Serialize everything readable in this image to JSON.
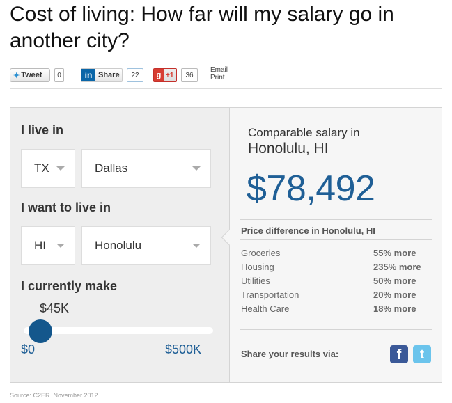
{
  "title": "Cost of living: How far will my salary go in another city?",
  "share": {
    "tweet_label": "Tweet",
    "tweet_count": "0",
    "linkedin_label": "Share",
    "linkedin_count": "22",
    "gplus_label": "+1",
    "gplus_count": "36",
    "email_label": "Email",
    "print_label": "Print"
  },
  "form": {
    "live_in_heading": "I live in",
    "current_state": "TX",
    "current_city": "Dallas",
    "want_heading": "I want to live in",
    "target_state": "HI",
    "target_city": "Honolulu",
    "make_heading": "I currently make",
    "salary_value": "$45K",
    "salary_fraction": 0.09,
    "slider_min": "$0",
    "slider_max": "$500K"
  },
  "results": {
    "comparable_line1": "Comparable salary in",
    "comparable_city": "Honolulu, HI",
    "comparable_salary": "$78,492",
    "diff_title": "Price difference in Honolulu, HI",
    "rows": [
      {
        "label": "Groceries",
        "value": "55% more"
      },
      {
        "label": "Housing",
        "value": "235% more"
      },
      {
        "label": "Utilities",
        "value": "50% more"
      },
      {
        "label": "Transportation",
        "value": "20% more"
      },
      {
        "label": "Health Care",
        "value": "18% more"
      }
    ],
    "share_label": "Share your results via:"
  },
  "source": "Source: C2ER. November 2012",
  "colors": {
    "accent": "#1f5f96",
    "slider_knob": "#14578c",
    "facebook": "#3b5998",
    "twitter": "#6bc4ec"
  }
}
